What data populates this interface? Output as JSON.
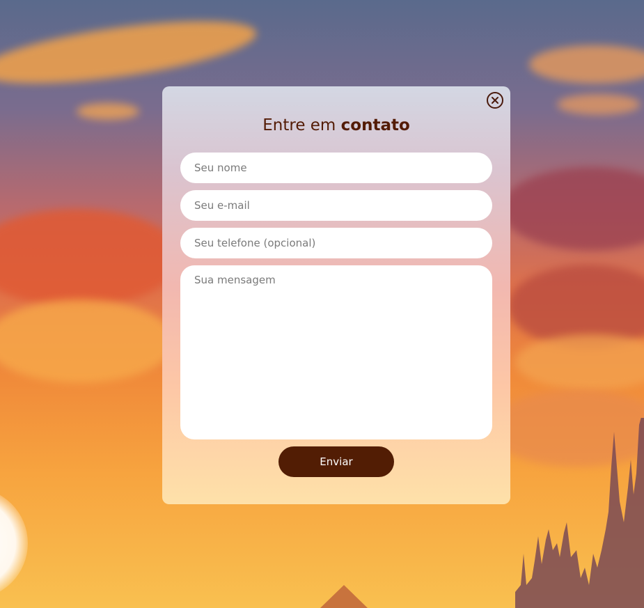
{
  "contact_modal": {
    "title_regular": "Entre em ",
    "title_bold": "contato",
    "close_icon": "close-circle-icon",
    "fields": {
      "name_placeholder": "Seu nome",
      "email_placeholder": "Seu e-mail",
      "phone_placeholder": "Seu telefone (opcional)",
      "message_placeholder": "Sua mensagem"
    },
    "submit_label": "Enviar"
  },
  "colors": {
    "accent": "#521d04",
    "title_text": "#531b05",
    "field_background": "#ffffff"
  }
}
